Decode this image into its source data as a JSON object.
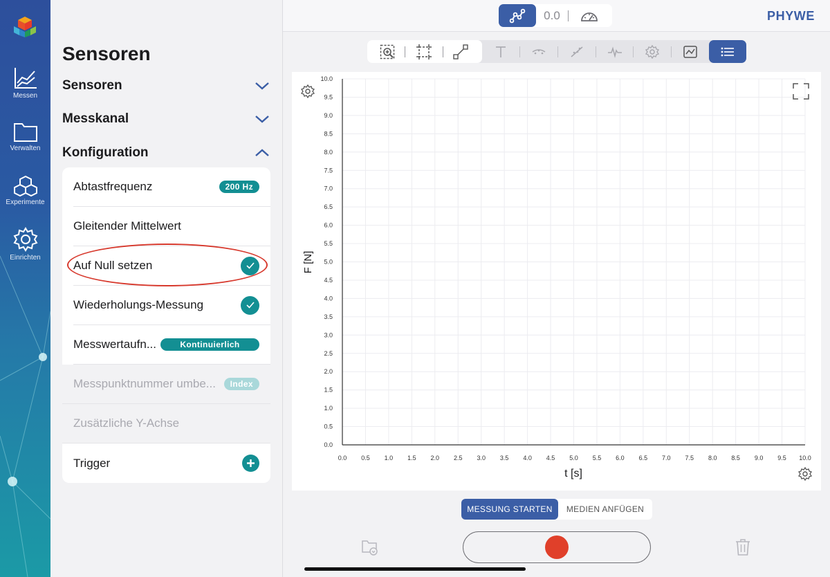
{
  "rail": {
    "items": [
      {
        "label": "Messen",
        "icon": "chart-icon"
      },
      {
        "label": "Verwalten",
        "icon": "folder-icon"
      },
      {
        "label": "Experimente",
        "icon": "cubes-icon"
      },
      {
        "label": "Einrichten",
        "icon": "gear-icon"
      }
    ]
  },
  "topbar": {
    "value": "0.0",
    "brand": "PHYWE"
  },
  "sidebar": {
    "title": "Sensoren",
    "sections": [
      {
        "label": "Sensoren",
        "expanded": false
      },
      {
        "label": "Messkanal",
        "expanded": false
      },
      {
        "label": "Konfiguration",
        "expanded": true
      }
    ],
    "config": [
      {
        "label": "Abtastfrequenz",
        "badge": "200 Hz"
      },
      {
        "label": "Gleitender Mittelwert"
      },
      {
        "label": "Auf Null setzen",
        "checked": true
      },
      {
        "label": "Wiederholungs-Messung",
        "checked": true
      },
      {
        "label": "Messwertaufn...",
        "badge": "Kontinuierlich"
      },
      {
        "label": "Messpunktnummer umbe...",
        "badge": "Index",
        "disabled": true
      },
      {
        "label": "Zusätzliche Y-Achse",
        "disabled": true
      },
      {
        "label": "Trigger",
        "action": "add"
      }
    ]
  },
  "chart_data": {
    "type": "line",
    "xlabel": "t [s]",
    "ylabel": "F [N]",
    "xlim": [
      0,
      10
    ],
    "ylim": [
      0,
      10
    ],
    "x_ticks": [
      "0.0",
      "0.5",
      "1.0",
      "1.5",
      "2.0",
      "2.5",
      "3.0",
      "3.5",
      "4.0",
      "4.5",
      "5.0",
      "5.5",
      "6.0",
      "6.5",
      "7.0",
      "7.5",
      "8.0",
      "8.5",
      "9.0",
      "9.5",
      "10.0"
    ],
    "y_ticks": [
      "0.0",
      "0.5",
      "1.0",
      "1.5",
      "2.0",
      "2.5",
      "3.0",
      "3.5",
      "4.0",
      "4.5",
      "5.0",
      "5.5",
      "6.0",
      "6.5",
      "7.0",
      "7.5",
      "8.0",
      "8.5",
      "9.0",
      "9.5",
      "10.0"
    ],
    "grid": true,
    "series": []
  },
  "bottom": {
    "start_label": "MESSUNG STARTEN",
    "media_label": "MEDIEN ANFÜGEN"
  },
  "colors": {
    "accent": "#3b5ea6",
    "teal": "#138f93",
    "record": "#e0402a",
    "highlight": "#d7392d"
  }
}
